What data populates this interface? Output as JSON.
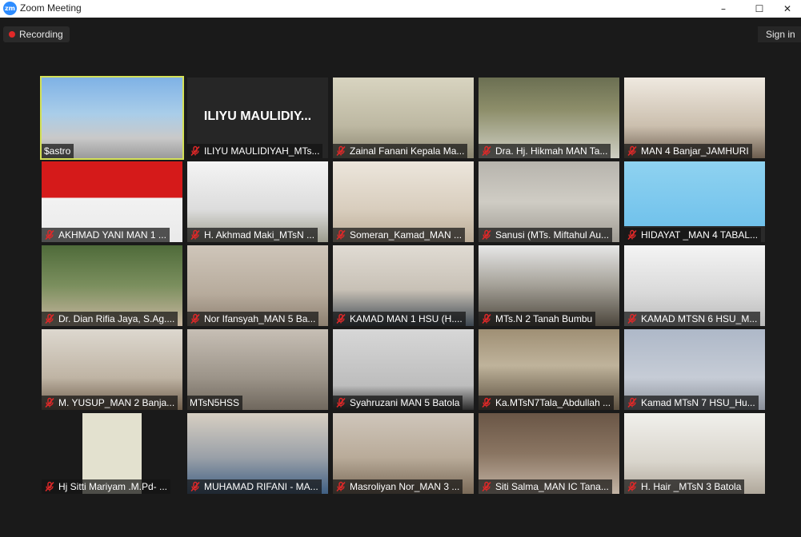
{
  "window": {
    "title": "Zoom Meeting",
    "logo_text": "zm"
  },
  "toolbar": {
    "recording_label": "Recording",
    "sign_in_label": "Sign in"
  },
  "colors": {
    "accent": "#2d8cff",
    "active_speaker": "#d4e157",
    "recording": "#e02828",
    "muted": "#e02828"
  },
  "participants": [
    {
      "name": "$astro",
      "muted": false,
      "active": true
    },
    {
      "name": "ILIYU MAULIDIYAH_MTs...",
      "muted": true,
      "display_name": "ILIYU MAULIDIY..."
    },
    {
      "name": "Zainal Fanani Kepala Ma...",
      "muted": true
    },
    {
      "name": "Dra. Hj. Hikmah MAN Ta...",
      "muted": true
    },
    {
      "name": "MAN 4 Banjar_JAMHURI",
      "muted": true
    },
    {
      "name": "AKHMAD YANI MAN 1 ...",
      "muted": true
    },
    {
      "name": "H. Akhmad Maki_MTsN ...",
      "muted": true
    },
    {
      "name": "Someran_Kamad_MAN ...",
      "muted": true
    },
    {
      "name": "Sanusi (MTs. Miftahul Au...",
      "muted": true
    },
    {
      "name": "HIDAYAT _MAN 4 TABAL...",
      "muted": true
    },
    {
      "name": "Dr. Dian Rifia Jaya, S.Ag....",
      "muted": true
    },
    {
      "name": "Nor Ifansyah_MAN 5 Ba...",
      "muted": true
    },
    {
      "name": "KAMAD MAN 1 HSU (H....",
      "muted": true
    },
    {
      "name": "MTs.N 2 Tanah Bumbu",
      "muted": true
    },
    {
      "name": "KAMAD MTSN 6 HSU_M...",
      "muted": true
    },
    {
      "name": "M. YUSUP_MAN 2 Banja...",
      "muted": true
    },
    {
      "name": "MTsN5HSS",
      "muted": false
    },
    {
      "name": "Syahruzani MAN 5 Batola",
      "muted": true
    },
    {
      "name": "Ka.MTsN7Tala_Abdullah ...",
      "muted": true
    },
    {
      "name": "Kamad MTsN 7 HSU_Hu...",
      "muted": true
    },
    {
      "name": "Hj Sitti Mariyam .M.Pd- ...",
      "muted": true
    },
    {
      "name": "MUHAMAD RIFANI - MA...",
      "muted": true
    },
    {
      "name": "Masroliyan Nor_MAN 3 ...",
      "muted": true
    },
    {
      "name": "Siti Salma_MAN IC Tana...",
      "muted": true
    },
    {
      "name": "H. Hair _MTsN 3 Batola",
      "muted": true
    }
  ]
}
